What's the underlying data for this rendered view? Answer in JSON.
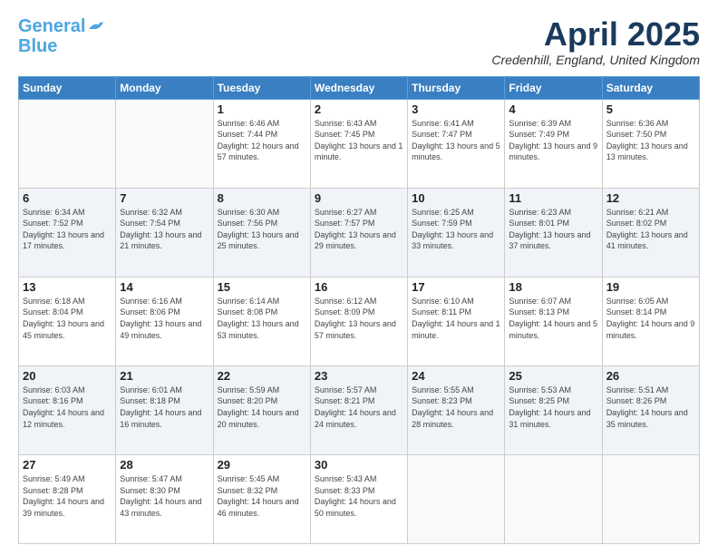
{
  "header": {
    "logo_line1": "General",
    "logo_line2": "Blue",
    "month": "April 2025",
    "location": "Credenhill, England, United Kingdom"
  },
  "days_of_week": [
    "Sunday",
    "Monday",
    "Tuesday",
    "Wednesday",
    "Thursday",
    "Friday",
    "Saturday"
  ],
  "weeks": [
    [
      {
        "day": "",
        "sunrise": "",
        "sunset": "",
        "daylight": ""
      },
      {
        "day": "",
        "sunrise": "",
        "sunset": "",
        "daylight": ""
      },
      {
        "day": "1",
        "sunrise": "Sunrise: 6:46 AM",
        "sunset": "Sunset: 7:44 PM",
        "daylight": "Daylight: 12 hours and 57 minutes."
      },
      {
        "day": "2",
        "sunrise": "Sunrise: 6:43 AM",
        "sunset": "Sunset: 7:45 PM",
        "daylight": "Daylight: 13 hours and 1 minute."
      },
      {
        "day": "3",
        "sunrise": "Sunrise: 6:41 AM",
        "sunset": "Sunset: 7:47 PM",
        "daylight": "Daylight: 13 hours and 5 minutes."
      },
      {
        "day": "4",
        "sunrise": "Sunrise: 6:39 AM",
        "sunset": "Sunset: 7:49 PM",
        "daylight": "Daylight: 13 hours and 9 minutes."
      },
      {
        "day": "5",
        "sunrise": "Sunrise: 6:36 AM",
        "sunset": "Sunset: 7:50 PM",
        "daylight": "Daylight: 13 hours and 13 minutes."
      }
    ],
    [
      {
        "day": "6",
        "sunrise": "Sunrise: 6:34 AM",
        "sunset": "Sunset: 7:52 PM",
        "daylight": "Daylight: 13 hours and 17 minutes."
      },
      {
        "day": "7",
        "sunrise": "Sunrise: 6:32 AM",
        "sunset": "Sunset: 7:54 PM",
        "daylight": "Daylight: 13 hours and 21 minutes."
      },
      {
        "day": "8",
        "sunrise": "Sunrise: 6:30 AM",
        "sunset": "Sunset: 7:56 PM",
        "daylight": "Daylight: 13 hours and 25 minutes."
      },
      {
        "day": "9",
        "sunrise": "Sunrise: 6:27 AM",
        "sunset": "Sunset: 7:57 PM",
        "daylight": "Daylight: 13 hours and 29 minutes."
      },
      {
        "day": "10",
        "sunrise": "Sunrise: 6:25 AM",
        "sunset": "Sunset: 7:59 PM",
        "daylight": "Daylight: 13 hours and 33 minutes."
      },
      {
        "day": "11",
        "sunrise": "Sunrise: 6:23 AM",
        "sunset": "Sunset: 8:01 PM",
        "daylight": "Daylight: 13 hours and 37 minutes."
      },
      {
        "day": "12",
        "sunrise": "Sunrise: 6:21 AM",
        "sunset": "Sunset: 8:02 PM",
        "daylight": "Daylight: 13 hours and 41 minutes."
      }
    ],
    [
      {
        "day": "13",
        "sunrise": "Sunrise: 6:18 AM",
        "sunset": "Sunset: 8:04 PM",
        "daylight": "Daylight: 13 hours and 45 minutes."
      },
      {
        "day": "14",
        "sunrise": "Sunrise: 6:16 AM",
        "sunset": "Sunset: 8:06 PM",
        "daylight": "Daylight: 13 hours and 49 minutes."
      },
      {
        "day": "15",
        "sunrise": "Sunrise: 6:14 AM",
        "sunset": "Sunset: 8:08 PM",
        "daylight": "Daylight: 13 hours and 53 minutes."
      },
      {
        "day": "16",
        "sunrise": "Sunrise: 6:12 AM",
        "sunset": "Sunset: 8:09 PM",
        "daylight": "Daylight: 13 hours and 57 minutes."
      },
      {
        "day": "17",
        "sunrise": "Sunrise: 6:10 AM",
        "sunset": "Sunset: 8:11 PM",
        "daylight": "Daylight: 14 hours and 1 minute."
      },
      {
        "day": "18",
        "sunrise": "Sunrise: 6:07 AM",
        "sunset": "Sunset: 8:13 PM",
        "daylight": "Daylight: 14 hours and 5 minutes."
      },
      {
        "day": "19",
        "sunrise": "Sunrise: 6:05 AM",
        "sunset": "Sunset: 8:14 PM",
        "daylight": "Daylight: 14 hours and 9 minutes."
      }
    ],
    [
      {
        "day": "20",
        "sunrise": "Sunrise: 6:03 AM",
        "sunset": "Sunset: 8:16 PM",
        "daylight": "Daylight: 14 hours and 12 minutes."
      },
      {
        "day": "21",
        "sunrise": "Sunrise: 6:01 AM",
        "sunset": "Sunset: 8:18 PM",
        "daylight": "Daylight: 14 hours and 16 minutes."
      },
      {
        "day": "22",
        "sunrise": "Sunrise: 5:59 AM",
        "sunset": "Sunset: 8:20 PM",
        "daylight": "Daylight: 14 hours and 20 minutes."
      },
      {
        "day": "23",
        "sunrise": "Sunrise: 5:57 AM",
        "sunset": "Sunset: 8:21 PM",
        "daylight": "Daylight: 14 hours and 24 minutes."
      },
      {
        "day": "24",
        "sunrise": "Sunrise: 5:55 AM",
        "sunset": "Sunset: 8:23 PM",
        "daylight": "Daylight: 14 hours and 28 minutes."
      },
      {
        "day": "25",
        "sunrise": "Sunrise: 5:53 AM",
        "sunset": "Sunset: 8:25 PM",
        "daylight": "Daylight: 14 hours and 31 minutes."
      },
      {
        "day": "26",
        "sunrise": "Sunrise: 5:51 AM",
        "sunset": "Sunset: 8:26 PM",
        "daylight": "Daylight: 14 hours and 35 minutes."
      }
    ],
    [
      {
        "day": "27",
        "sunrise": "Sunrise: 5:49 AM",
        "sunset": "Sunset: 8:28 PM",
        "daylight": "Daylight: 14 hours and 39 minutes."
      },
      {
        "day": "28",
        "sunrise": "Sunrise: 5:47 AM",
        "sunset": "Sunset: 8:30 PM",
        "daylight": "Daylight: 14 hours and 43 minutes."
      },
      {
        "day": "29",
        "sunrise": "Sunrise: 5:45 AM",
        "sunset": "Sunset: 8:32 PM",
        "daylight": "Daylight: 14 hours and 46 minutes."
      },
      {
        "day": "30",
        "sunrise": "Sunrise: 5:43 AM",
        "sunset": "Sunset: 8:33 PM",
        "daylight": "Daylight: 14 hours and 50 minutes."
      },
      {
        "day": "",
        "sunrise": "",
        "sunset": "",
        "daylight": ""
      },
      {
        "day": "",
        "sunrise": "",
        "sunset": "",
        "daylight": ""
      },
      {
        "day": "",
        "sunrise": "",
        "sunset": "",
        "daylight": ""
      }
    ]
  ]
}
